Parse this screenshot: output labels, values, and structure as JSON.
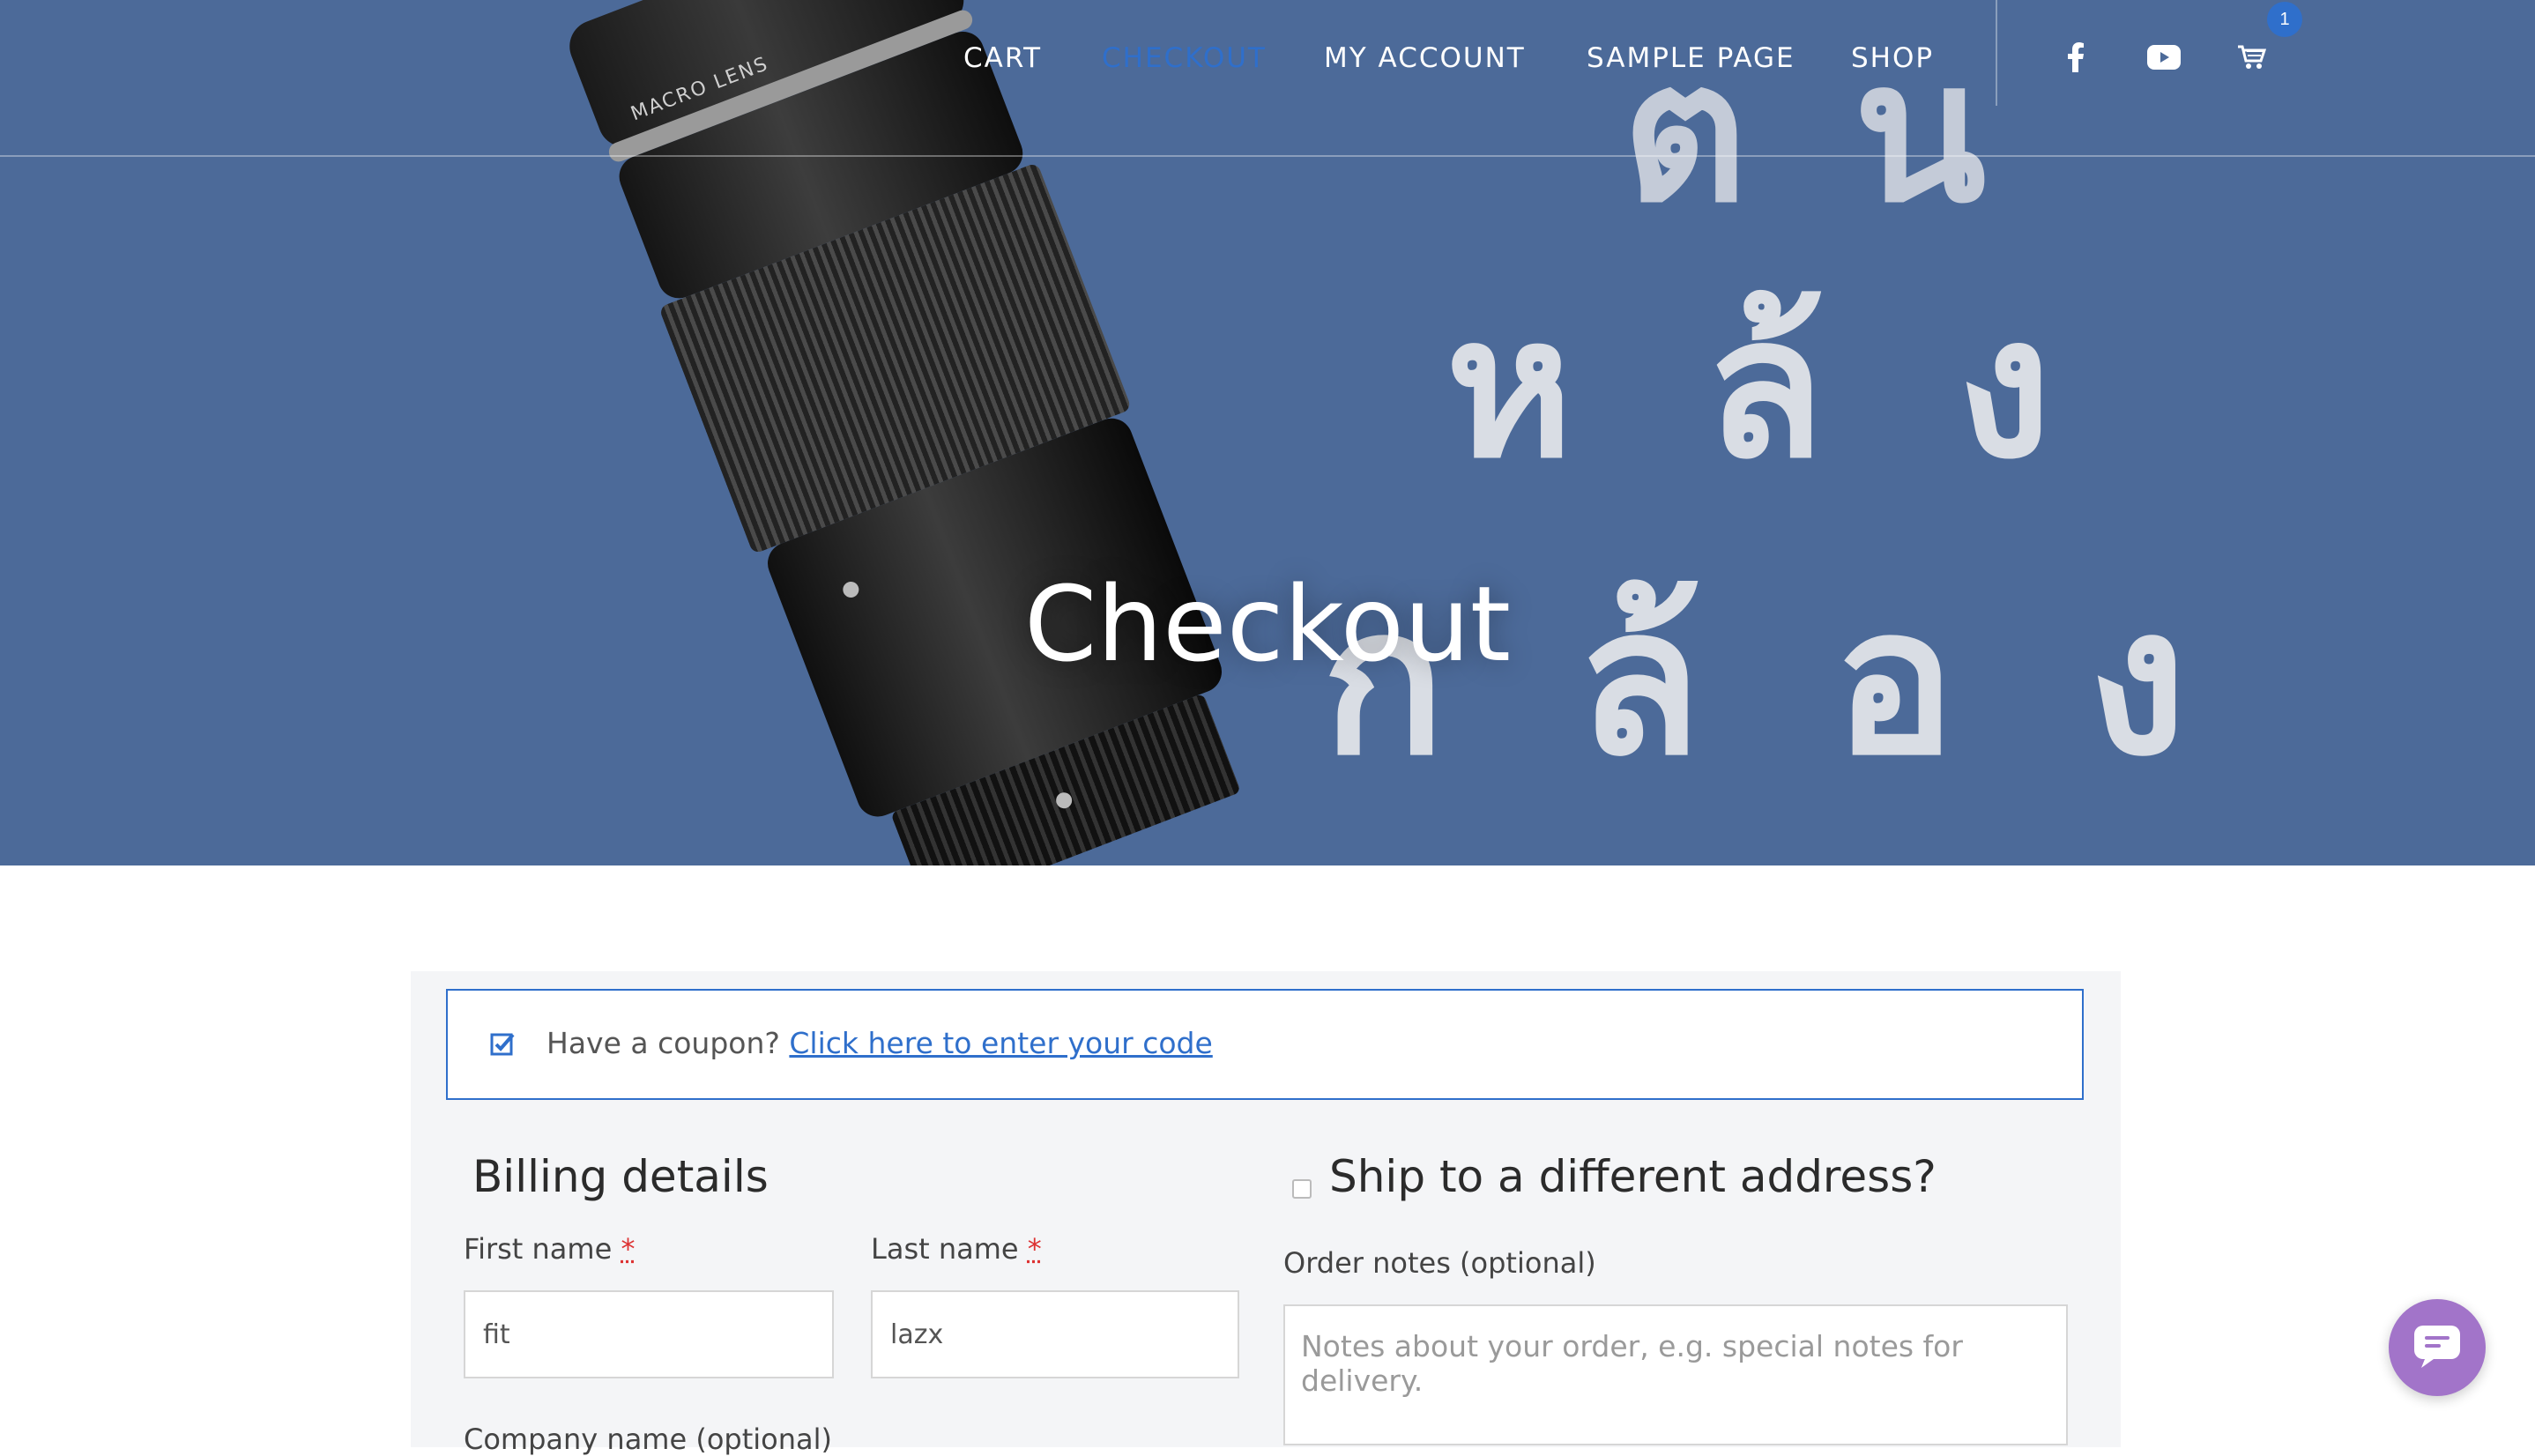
{
  "nav": {
    "items": [
      {
        "label": "CART",
        "active": false
      },
      {
        "label": "CHECKOUT",
        "active": true
      },
      {
        "label": "MY ACCOUNT",
        "active": false
      },
      {
        "label": "SAMPLE PAGE",
        "active": false
      },
      {
        "label": "SHOP",
        "active": false
      }
    ],
    "social_icons": [
      "facebook-icon",
      "youtube-icon"
    ],
    "cart_icon": "cart-icon",
    "cart_count": "1"
  },
  "hero": {
    "title": "Checkout",
    "background_text": {
      "row1": "ตน",
      "row2": "หล้ง",
      "row3": "กล้อง"
    },
    "lens_label": "MACRO LENS"
  },
  "coupon": {
    "prompt": "Have a coupon?",
    "link": "Click here to enter your code",
    "icon": "checkbox-checked-icon"
  },
  "billing": {
    "heading": "Billing details",
    "first_name": {
      "label": "First name",
      "required": "*",
      "value": "fit"
    },
    "last_name": {
      "label": "Last name",
      "required": "*",
      "value": "lazx"
    },
    "next_label_partial": "Company name (optional)"
  },
  "shipping": {
    "heading": "Ship to a different address?",
    "checked": false,
    "order_notes": {
      "label": "Order notes (optional)",
      "placeholder": "Notes about your order, e.g. special notes for delivery."
    }
  },
  "chat": {
    "icon": "chat-icon"
  },
  "colors": {
    "hero_bg": "#4c6a99",
    "accent": "#2f6fcb",
    "chat": "#a274c9",
    "panel_bg": "#f4f5f7"
  }
}
